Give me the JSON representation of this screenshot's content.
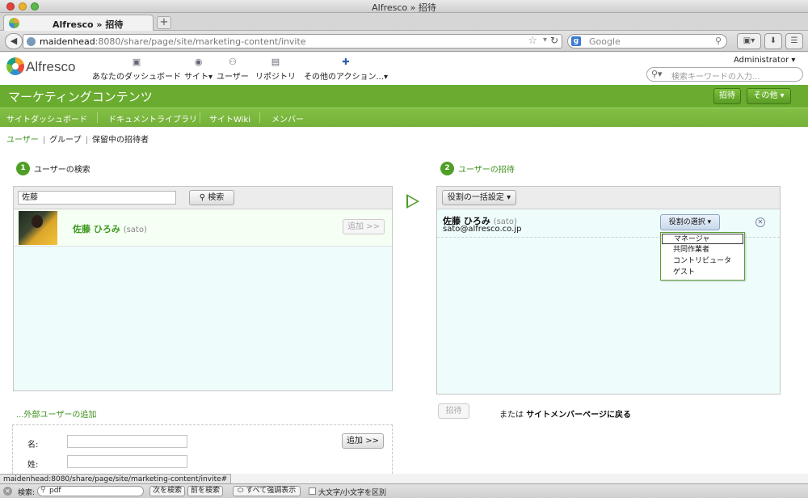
{
  "window": {
    "title": "Alfresco » 招待"
  },
  "tab": {
    "label": "Alfresco » 招待",
    "new_tab": "+"
  },
  "nav": {
    "back": "◀",
    "url_host": "maidenhead",
    "url_rest": ":8080/share/page/site/marketing-content/invite",
    "search_placeholder": "Google",
    "google_glyph": "g"
  },
  "header": {
    "logo_text": "Alfresco",
    "items": [
      {
        "label": "あなたのダッシュボード",
        "icon": "▣"
      },
      {
        "label": "サイト",
        "icon": "◉"
      },
      {
        "label": "ユーザー",
        "icon": "⚇"
      },
      {
        "label": "リポジトリ",
        "icon": "▤"
      },
      {
        "label": "その他のアクション...",
        "icon": "✚"
      }
    ],
    "user": "Administrator",
    "search_placeholder": "検索キーワードの入力..."
  },
  "site": {
    "title": "マーケティングコンテンツ",
    "invite_button": "招待",
    "more_button": "その他",
    "nav": [
      "サイトダッシュボード",
      "ドキュメントライブラリ",
      "サイトWiki",
      "メンバー"
    ]
  },
  "breadcrumb": {
    "users": "ユーザー",
    "groups": "グループ",
    "pending": "保留中の招待者"
  },
  "step1": {
    "num": "1",
    "label": "ユーザーの検索",
    "query": "佐藤",
    "search_button": "検索",
    "results": [
      {
        "name": "佐藤 ひろみ",
        "id": "(sato)",
        "add_button": "追加 >>"
      }
    ]
  },
  "step2": {
    "num": "2",
    "label": "ユーザーの招待",
    "bulk_role_button": "役割の一括設定",
    "invitees": [
      {
        "name": "佐藤 ひろみ",
        "id": "(sato)",
        "email": "sato@alfresco.co.jp",
        "role_button": "役割の選択"
      }
    ],
    "role_options": [
      "マネージャ",
      "共同作業者",
      "コントリビュータ",
      "ゲスト"
    ]
  },
  "external": {
    "title": "...外部ユーザーの追加",
    "first_name_label": "名:",
    "last_name_label": "姓:",
    "add_button": "追加 >>"
  },
  "invite_action": {
    "invite_button": "招待",
    "or_text": "または",
    "back_link": "サイトメンバーページに戻る"
  },
  "status": {
    "url": "maidenhead:8080/share/page/site/marketing-content/invite#"
  },
  "findbar": {
    "label": "検索:",
    "query": "pdf",
    "next": "次を検索",
    "prev": "前を検索",
    "highlight": "すべて強調表示",
    "match_case": "大文字/小文字を区別"
  }
}
